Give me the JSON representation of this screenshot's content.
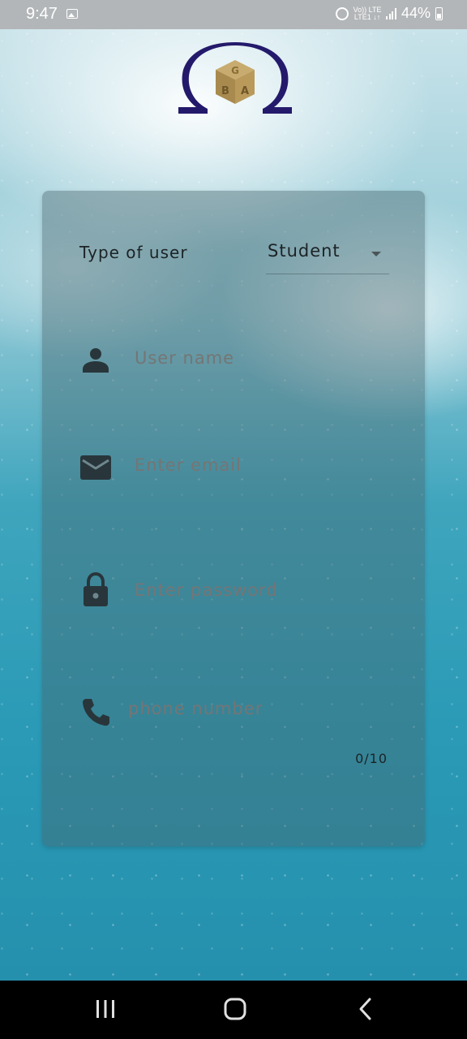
{
  "status_bar": {
    "time": "9:47",
    "network_top": "Vo)) LTE",
    "network_bottom": "LTE1 ↓↑",
    "battery_percent": "44%",
    "icons": [
      "gallery-icon",
      "alarm-icon",
      "signal-icon",
      "battery-icon"
    ]
  },
  "logo": {
    "letters": [
      "G",
      "B",
      "A"
    ],
    "colors": {
      "omega": "#241a6b",
      "cube": "#b99a5b"
    }
  },
  "form": {
    "user_type_label": "Type of user",
    "user_type_value": "Student",
    "fields": [
      {
        "icon": "person-icon",
        "placeholder": "User name"
      },
      {
        "icon": "email-icon",
        "placeholder": "Enter email"
      },
      {
        "icon": "lock-icon",
        "placeholder": "Enter password"
      },
      {
        "icon": "phone-icon",
        "placeholder": "phone number"
      }
    ],
    "phone_counter": "0/10"
  },
  "nav_bar": {
    "buttons": [
      "recent-apps",
      "home",
      "back"
    ]
  },
  "colors": {
    "card": "rgba(72,100,108,0.42)",
    "text": "#1c2326",
    "icon": "#28363b"
  }
}
